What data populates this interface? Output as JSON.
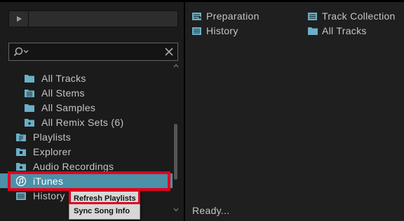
{
  "preview": {
    "play_icon": "play-icon"
  },
  "search": {
    "value": ""
  },
  "tree": {
    "items": [
      {
        "label": "All Tracks",
        "icon": "folder-icon"
      },
      {
        "label": "All Stems",
        "icon": "stems-icon"
      },
      {
        "label": "All Samples",
        "icon": "folder-icon"
      },
      {
        "label": "All Remix Sets (6)",
        "icon": "remix-set-icon"
      },
      {
        "label": "Playlists",
        "icon": "playlist-folder-icon"
      },
      {
        "label": "Explorer",
        "icon": "explorer-folder-icon"
      },
      {
        "label": "Audio Recordings",
        "icon": "recordings-folder-icon"
      },
      {
        "label": "iTunes",
        "icon": "itunes-icon"
      },
      {
        "label": "History",
        "icon": "history-icon"
      }
    ]
  },
  "context_menu": {
    "items": [
      "Refresh Playlists",
      "Sync Song Info"
    ]
  },
  "favorites": {
    "items": [
      {
        "label": "Preparation",
        "icon": "preparation-icon"
      },
      {
        "label": "Track Collection",
        "icon": "track-collection-icon"
      },
      {
        "label": "History",
        "icon": "history-icon"
      },
      {
        "label": "All Tracks",
        "icon": "folder-icon"
      }
    ]
  },
  "status": {
    "text": "Ready..."
  },
  "colors": {
    "selection": "#4b91a8",
    "highlight_box": "#e3001b",
    "icon_blue": "#6ab0c8"
  }
}
